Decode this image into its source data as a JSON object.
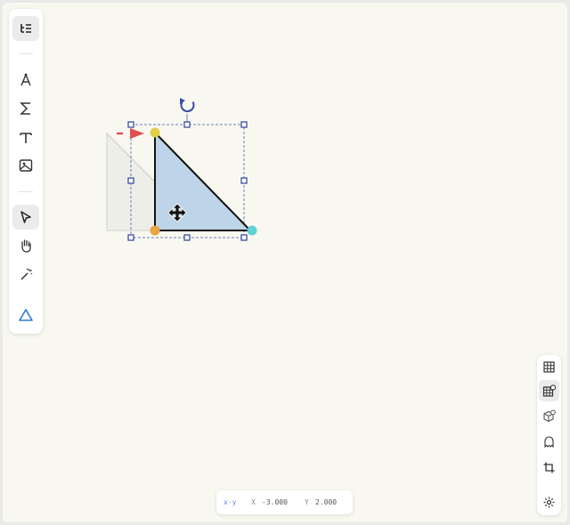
{
  "left_toolbar": {
    "items": [
      {
        "icon": "algebra-view-icon",
        "active": true
      },
      {
        "icon": "compass-icon"
      },
      {
        "icon": "sigma-icon"
      },
      {
        "icon": "text-tool-icon"
      },
      {
        "icon": "image-icon"
      },
      {
        "icon": "select-arrow-icon",
        "active": true
      },
      {
        "icon": "hand-pan-icon"
      },
      {
        "icon": "magic-wand-icon"
      },
      {
        "icon": "triangle-shape-icon",
        "accent": "#2f7ad9"
      }
    ]
  },
  "right_toolbar": {
    "items": [
      {
        "icon": "grid-icon"
      },
      {
        "icon": "grid-settings-icon",
        "active": true
      },
      {
        "icon": "cube-icon"
      },
      {
        "icon": "ghost-icon"
      },
      {
        "icon": "crop-icon"
      },
      {
        "icon": "settings-gear-icon"
      }
    ]
  },
  "coords": {
    "mode_label": "x·y",
    "x_label": "X",
    "x_value": "-3.000",
    "y_label": "Y",
    "y_value": "2.000"
  },
  "colors": {
    "canvas_bg": "#f8f8f1",
    "triangle_fill": "#bed4e8",
    "ghost_fill": "#eeeee8",
    "handle": "#3b4da0",
    "vertex_top": "#e2cf48",
    "vertex_bottom_left": "#e6a645",
    "vertex_right": "#5fd0d4",
    "arrow": "#e05050"
  }
}
